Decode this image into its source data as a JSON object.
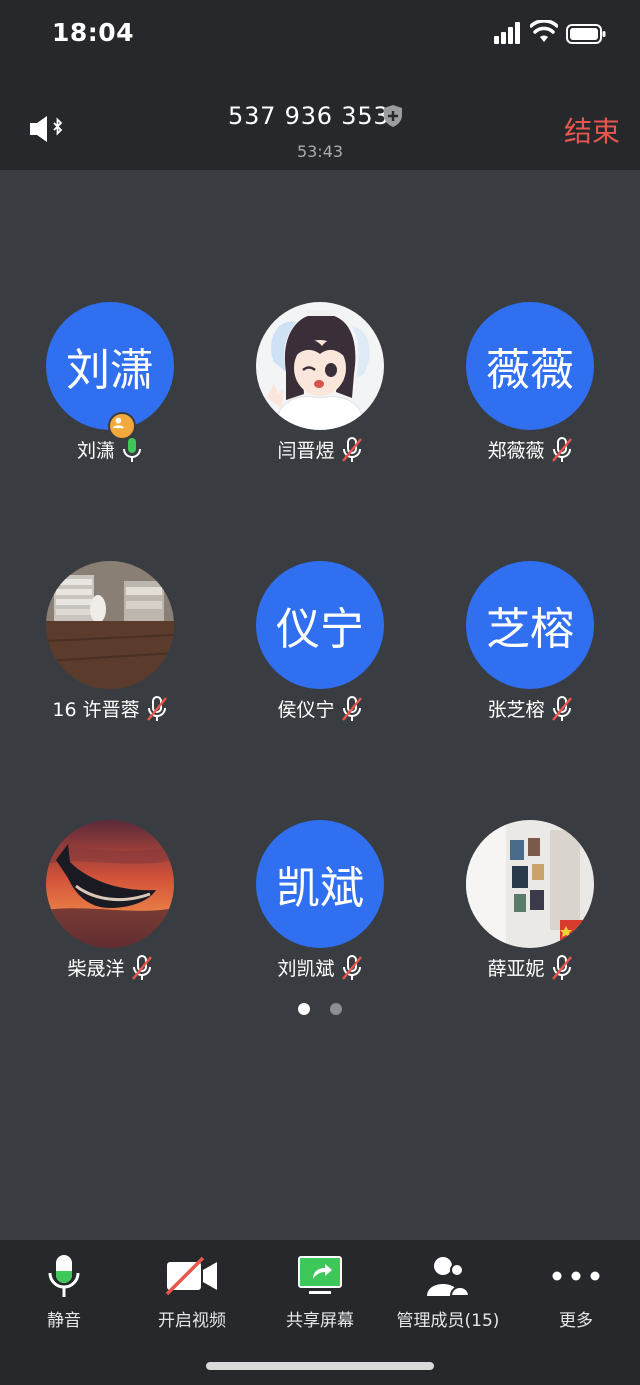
{
  "status_bar": {
    "time": "18:04"
  },
  "header": {
    "meeting_id": "537 936 353",
    "duration": "53:43",
    "end_label": "结束"
  },
  "participants": [
    {
      "name": "刘潇",
      "avatar_text": "刘潇",
      "avatar_type": "text",
      "mic": "on",
      "host": true
    },
    {
      "name": "闫晋煜",
      "avatar_text": "",
      "avatar_type": "photo-anime-girl",
      "mic": "muted"
    },
    {
      "name": "郑薇薇",
      "avatar_text": "薇薇",
      "avatar_type": "text",
      "mic": "muted"
    },
    {
      "name": "16 许晋蓉",
      "avatar_text": "",
      "avatar_type": "photo-room",
      "mic": "muted"
    },
    {
      "name": "侯仪宁",
      "avatar_text": "仪宁",
      "avatar_type": "text",
      "mic": "muted"
    },
    {
      "name": "张芝榕",
      "avatar_text": "芝榕",
      "avatar_type": "text",
      "mic": "muted"
    },
    {
      "name": "柴晟洋",
      "avatar_text": "",
      "avatar_type": "photo-whale-sunset",
      "mic": "muted"
    },
    {
      "name": "刘凯斌",
      "avatar_text": "凯斌",
      "avatar_type": "text",
      "mic": "muted"
    },
    {
      "name": "薛亚妮",
      "avatar_text": "",
      "avatar_type": "photo-wall",
      "mic": "muted"
    }
  ],
  "pagination": {
    "pages": 2,
    "current": 1
  },
  "toolbar": {
    "mute": "静音",
    "video": "开启视频",
    "share": "共享屏幕",
    "members": "管理成员(15)",
    "more": "更多"
  },
  "colors": {
    "accent_blue": "#2f6ff0",
    "end_red": "#e8574d",
    "mic_green": "#3ec85a",
    "muted_red": "#e8574d",
    "host_orange": "#f0a93a"
  }
}
